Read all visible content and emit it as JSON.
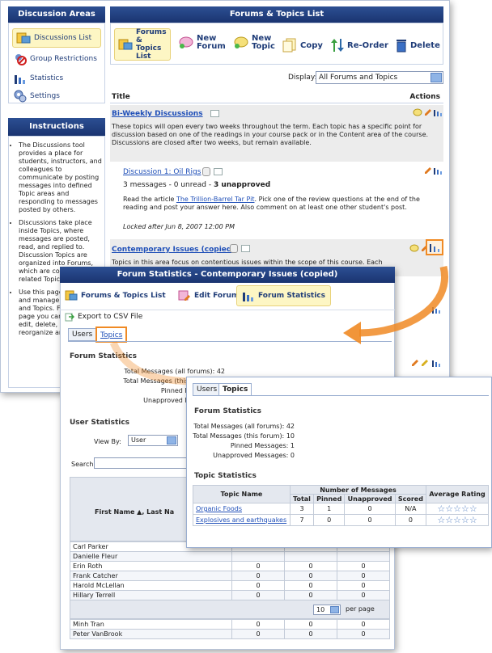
{
  "left": {
    "areas_title": "Discussion Areas",
    "nav": [
      {
        "label": "Discussions List",
        "icon": "discussions-list-icon"
      },
      {
        "label": "Group Restrictions",
        "icon": "group-restrictions-icon"
      },
      {
        "label": "Statistics",
        "icon": "statistics-icon"
      },
      {
        "label": "Settings",
        "icon": "settings-icon"
      }
    ],
    "instructions_title": "Instructions",
    "instructions": [
      "The Discussions tool provides a place for students, instructors, and colleagues to communicate by posting messages into defined Topic areas and responding to messages posted by others.",
      "Discussions take place inside Topics, where messages are posted, read, and replied to. Discussion Topics are organized into Forums, which are collections of related Topics.",
      "Use this page to create and manage your Forums and Topics. From this page you can create, edit, delete, copy, reorganize and topics"
    ]
  },
  "main": {
    "title": "Forums & Topics List",
    "toolbar": {
      "forums": "Forums & Topics List",
      "new_forum": "New Forum",
      "new_topic": "New Topic",
      "copy": "Copy",
      "reorder": "Re-Order",
      "delete": "Delete"
    },
    "display_label": "Display:",
    "display_value": "All Forums and Topics",
    "col_title": "Title",
    "col_actions": "Actions",
    "forum1": {
      "name": "Bi-Weekly Discussions",
      "desc": "These topics will open every two weeks throughout the term. Each topic has a specific point for discussion based on one of the readings in your course pack or in the Content area of the course. Discussions are closed after two weeks, but remain available."
    },
    "topic1": {
      "name": "Discussion 1: Oil Rigs",
      "counts_a": "3 messages - 0 unread - ",
      "counts_b": "3 unapproved",
      "read_a": "Read the article ",
      "article": "The Trillion-Barrel Tar Pit",
      "read_b": ". Pick one of the review questions at the end of the reading and post your answer here. Also comment on at least one other student's post.",
      "locked": "Locked after Jun 8, 2007 12:00 PM"
    },
    "forum2": {
      "name": "Contemporary Issues (copied)",
      "desc": "Topics in this area focus on contentious issues within the scope of this course. Each"
    }
  },
  "stats": {
    "title": "Forum Statistics - Contemporary Issues (copied)",
    "btn_list": "Forums & Topics List",
    "btn_edit": "Edit Forum",
    "btn_stats": "Forum Statistics",
    "export": "Export to CSV File",
    "tab_users": "Users",
    "tab_topics": "Topics",
    "forum_stats_heading": "Forum Statistics",
    "total_all_label": "Total Messages (all forums):",
    "total_all": "42",
    "total_this_label": "Total Messages (this forum):",
    "total_this": "10",
    "pinned_label": "Pinned Messages:",
    "pinned": "1",
    "unapproved_label": "Unapproved Messages:",
    "unapproved": "0",
    "user_stats_heading": "User Statistics",
    "view_by_label": "View By:",
    "view_by_value": "User",
    "search_label": "Search For:",
    "col_name": "First Name ▲, Last Na",
    "users": [
      {
        "name": "Carl Parker",
        "a": "",
        "b": "",
        "c": ""
      },
      {
        "name": "Danielle Fleur",
        "a": "",
        "b": "",
        "c": ""
      },
      {
        "name": "Erin Roth",
        "a": "0",
        "b": "0",
        "c": "0"
      },
      {
        "name": "Frank Catcher",
        "a": "0",
        "b": "0",
        "c": "0"
      },
      {
        "name": "Harold McLellan",
        "a": "0",
        "b": "0",
        "c": "0"
      },
      {
        "name": "Hillary Terrell",
        "a": "0",
        "b": "0",
        "c": "0"
      },
      {
        "name": "Jodi Singh",
        "a": "0",
        "b": "0",
        "c": "0"
      },
      {
        "name": "Miguel Mendoza",
        "a": "0",
        "b": "0",
        "c": "0"
      },
      {
        "name": "Minh Tran",
        "a": "0",
        "b": "0",
        "c": "0"
      },
      {
        "name": "Peter VanBrook",
        "a": "0",
        "b": "0",
        "c": "0"
      }
    ],
    "per_page_value": "10",
    "per_page_label": "per page"
  },
  "zoom": {
    "tab_users": "Users",
    "tab_topics": "Topics",
    "forum_stats_heading": "Forum Statistics",
    "total_all_label": "Total Messages (all forums):",
    "total_all": "42",
    "total_this_label": "Total Messages (this forum):",
    "total_this": "10",
    "pinned_label": "Pinned Messages:",
    "pinned": "1",
    "unapproved_label": "Unapproved Messages:",
    "unapproved": "0",
    "topic_stats_heading": "Topic Statistics",
    "col_topic": "Topic Name",
    "col_number": "Number of Messages",
    "col_total": "Total",
    "col_pinned": "Pinned",
    "col_unapproved": "Unapproved",
    "col_scored": "Scored",
    "col_rating": "Average Rating",
    "topics": [
      {
        "name": "Organic Foods",
        "total": "3",
        "pinned": "1",
        "unapproved": "0",
        "scored": "N/A",
        "rating": 0
      },
      {
        "name": "Explosives and earthquakes",
        "total": "7",
        "pinned": "0",
        "unapproved": "0",
        "scored": "0",
        "rating": 0
      }
    ]
  },
  "colors": {
    "header_blue": "#1f3c78",
    "highlight_yellow": "#fdf6c4",
    "callout_orange": "#f08a24",
    "link_blue": "#1f4fb8"
  }
}
